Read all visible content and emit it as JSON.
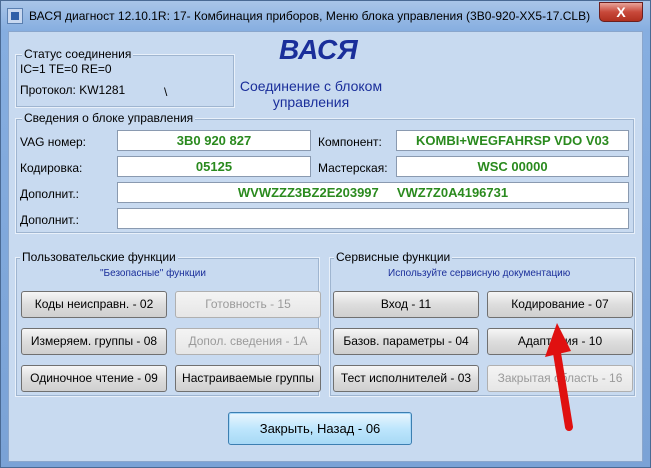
{
  "window": {
    "title": "ВАСЯ диагност 12.10.1R: 17- Комбинация приборов,  Меню блока управления (3B0-920-XX5-17.CLB)",
    "close_label": "X"
  },
  "header": {
    "app_name": "ВАСЯ",
    "subtitle": "Соединение с блоком управления"
  },
  "connection": {
    "title": "Статус соединения",
    "status": "IC=1  TE=0   RE=0",
    "protocol": "Протокол: KW1281",
    "spinner": "\\"
  },
  "ecu_info": {
    "title": "Сведения о блоке управления",
    "vag_label": "VAG номер:",
    "vag_value": "3B0 920 827",
    "component_label": "Компонент:",
    "component_value": "KOMBI+WEGFAHRSP VDO V03",
    "coding_label": "Кодировка:",
    "coding_value": "05125",
    "workshop_label": "Мастерская:",
    "workshop_value": "WSC 00000",
    "extra1_label": "Дополнит.:",
    "extra1_value": "WVWZZZ3BZ2E203997     VWZ7Z0A4196731",
    "extra2_label": "Дополнит.:",
    "extra2_value": ""
  },
  "user_functions": {
    "title": "Пользовательские функции",
    "hint": "\"Безопасные\" функции",
    "buttons": [
      {
        "label": "Коды неисправн. - 02"
      },
      {
        "label": "Готовность - 15"
      },
      {
        "label": "Измеряем. группы - 08"
      },
      {
        "label": "Допол. сведения - 1A"
      },
      {
        "label": "Одиночное чтение - 09"
      },
      {
        "label": "Настраиваемые группы"
      }
    ]
  },
  "service_functions": {
    "title": "Сервисные функции",
    "hint": "Используйте сервисную документацию",
    "buttons": [
      {
        "label": "Вход - 11"
      },
      {
        "label": "Кодирование - 07"
      },
      {
        "label": "Базов. параметры - 04"
      },
      {
        "label": "Адаптация - 10"
      },
      {
        "label": "Тест исполнителей - 03"
      },
      {
        "label": "Закрытая область - 16"
      }
    ]
  },
  "footer": {
    "close_back_label": "Закрыть, Назад - 06"
  },
  "colors": {
    "title_blue": "#1a2e9a",
    "value_green": "#2a8a1e",
    "annotation_red": "#e01010"
  }
}
